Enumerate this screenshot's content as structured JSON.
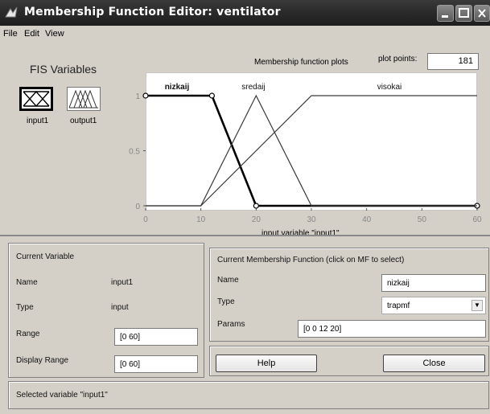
{
  "window": {
    "title": "Membership Function Editor: ventilator"
  },
  "menu": [
    "File",
    "Edit",
    "View"
  ],
  "fis_variables": {
    "label": "FIS Variables",
    "input_caption": "input1",
    "output_caption": "output1"
  },
  "plot_header": {
    "mf_plots_label": "Membership function plots",
    "plot_points_label": "plot points:",
    "plot_points_value": "181"
  },
  "chart_data": {
    "type": "line",
    "xlabel": "input variable \"input1\"",
    "xlim": [
      0,
      60
    ],
    "ylim": [
      0,
      1
    ],
    "x_ticks": [
      0,
      10,
      20,
      30,
      40,
      50,
      60
    ],
    "y_ticks": [
      0,
      0.5,
      1
    ],
    "x_tick_labels": [
      "0",
      "10",
      "20",
      "30",
      "40",
      "50",
      "60"
    ],
    "y_tick_labels": [
      "0",
      "0.5",
      "1"
    ],
    "series": [
      {
        "name": "nizkaij",
        "mf_type": "trapmf",
        "params": [
          0,
          0,
          12,
          20
        ],
        "x": [
          0,
          12,
          20,
          60
        ],
        "y": [
          1,
          1,
          0,
          0
        ],
        "selected": true
      },
      {
        "name": "sredaij",
        "mf_type": "trimf",
        "params": [
          10,
          20,
          30
        ],
        "x": [
          0,
          10,
          20,
          30,
          60
        ],
        "y": [
          0,
          0,
          1,
          0,
          0
        ],
        "selected": false
      },
      {
        "name": "visokai",
        "mf_type": "trapmf",
        "params": [
          10,
          30,
          60,
          60
        ],
        "x": [
          0,
          10,
          30,
          60
        ],
        "y": [
          0,
          0,
          1,
          1
        ],
        "selected": false
      }
    ]
  },
  "current_variable": {
    "panel_title": "Current Variable",
    "name_label": "Name",
    "name_value": "input1",
    "type_label": "Type",
    "type_value": "input",
    "range_label": "Range",
    "range_value": "[0 60]",
    "display_range_label": "Display Range",
    "display_range_value": "[0 60]"
  },
  "current_mf": {
    "panel_title": "Current Membership Function (click on MF to select)",
    "name_label": "Name",
    "name_value": "nizkaij",
    "type_label": "Type",
    "type_value": "trapmf",
    "params_label": "Params",
    "params_value": "[0 0 12 20]"
  },
  "buttons": {
    "help": "Help",
    "close": "Close"
  },
  "status": {
    "text": "Selected variable \"input1\""
  },
  "colors": {
    "title_bar": "#2a2a2a",
    "panel_bg": "#d4d0c8",
    "selected_mf": "#000000",
    "mf_line": "#3a3a3a"
  }
}
